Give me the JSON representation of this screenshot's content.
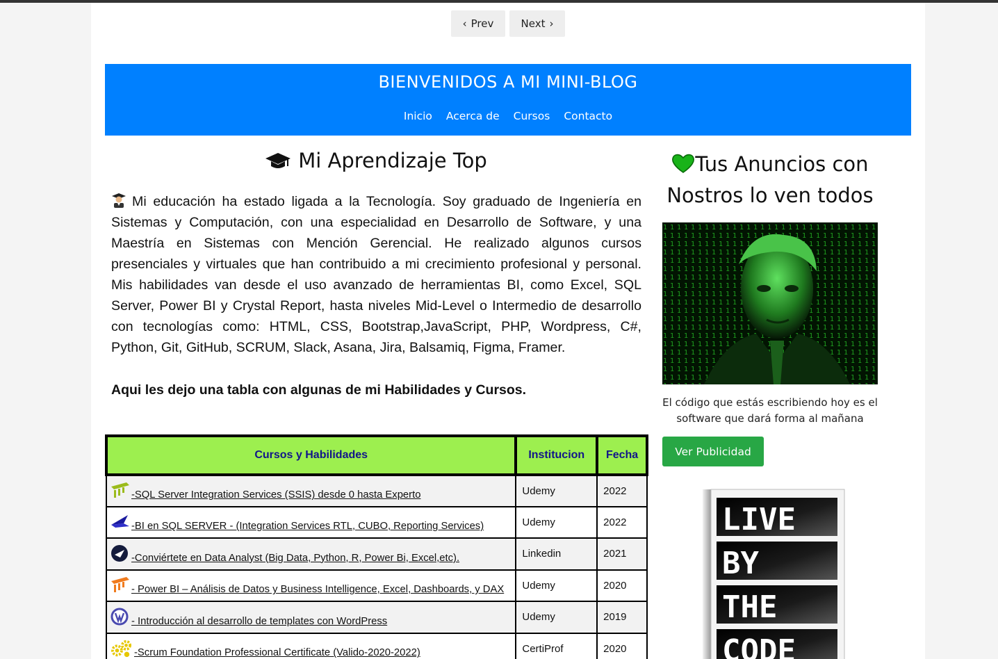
{
  "pager": {
    "prev": "Prev",
    "next": "Next"
  },
  "header": {
    "title": "BIENVENIDOS A MI MINI-BLOG",
    "nav": [
      "Inicio",
      "Acerca de",
      "Cursos",
      "Contacto"
    ]
  },
  "main": {
    "title": "Mi Aprendizaje Top",
    "paragraph": "Mi educación ha estado ligada a la Tecnología. Soy graduado de Ingeniería en Sistemas y Computación, con una especialidad en Desarrollo de Software, y una Maestría en Sistemas con Mención Gerencial. He realizado algunos cursos presenciales y virtuales que han contribuido a mi crecimiento profesional y personal. Mis habilidades van desde el uso avanzado de herramientas BI, como Excel, SQL Server, Power BI y Crystal Report, hasta niveles Mid-Level o Intermedio de desarrollo con tecnologías como: HTML, CSS, Bootstrap,JavaScript, PHP, Wordpress, C#, Python, Git, GitHub, SCRUM, Slack, Asana, Jira, Balsamiq, Figma, Framer.",
    "table_intro": "Aqui les dejo una tabla con algunas de mi Habilidades y Cursos."
  },
  "table": {
    "headers": [
      "Cursos y Habilidades",
      "Institucion",
      "Fecha"
    ],
    "rows": [
      {
        "course": "-SQL Server Integration Services (SSIS) desde 0 hasta Experto",
        "institution": "Udemy",
        "year": "2022",
        "icon": "udemy-ssis-icon"
      },
      {
        "course": "-BI en SQL SERVER - (Integration Services RTL, CUBO, Reporting Services)",
        "institution": "Udemy",
        "year": "2022",
        "icon": "bi-sql-icon"
      },
      {
        "course": "-Conviértete en Data Analyst (Big Data, Python, R, Power Bi, Excel,etc).",
        "institution": "Linkedin",
        "year": "2021",
        "icon": "data-analyst-icon"
      },
      {
        "course": "- Power BI – Análisis de Datos y Business Intelligence, Excel, Dashboards, y DAX",
        "institution": "Udemy",
        "year": "2020",
        "icon": "power-bi-icon"
      },
      {
        "course": "- Introducción al desarrollo de templates con WordPress",
        "institution": "Udemy",
        "year": "2019",
        "icon": "wordpress-icon"
      },
      {
        "course": "-Scrum Foundation Professional Certificate (Valido-2020-2022)",
        "institution": "CertiProf",
        "year": "2020",
        "icon": "scrum-gears-icon"
      }
    ]
  },
  "aside": {
    "title": "Tus Anuncios con Nostros lo ven todos",
    "caption": "El código que estás escribiendo hoy es el software que dará forma al mañana",
    "button": "Ver Publicidad",
    "book_words": [
      "LIVE",
      "BY",
      "THE",
      "CODE"
    ]
  },
  "colors": {
    "banner": "#0080ff",
    "table_header": "#9def4f",
    "table_header_text": "#12158a",
    "button": "#28a745"
  }
}
